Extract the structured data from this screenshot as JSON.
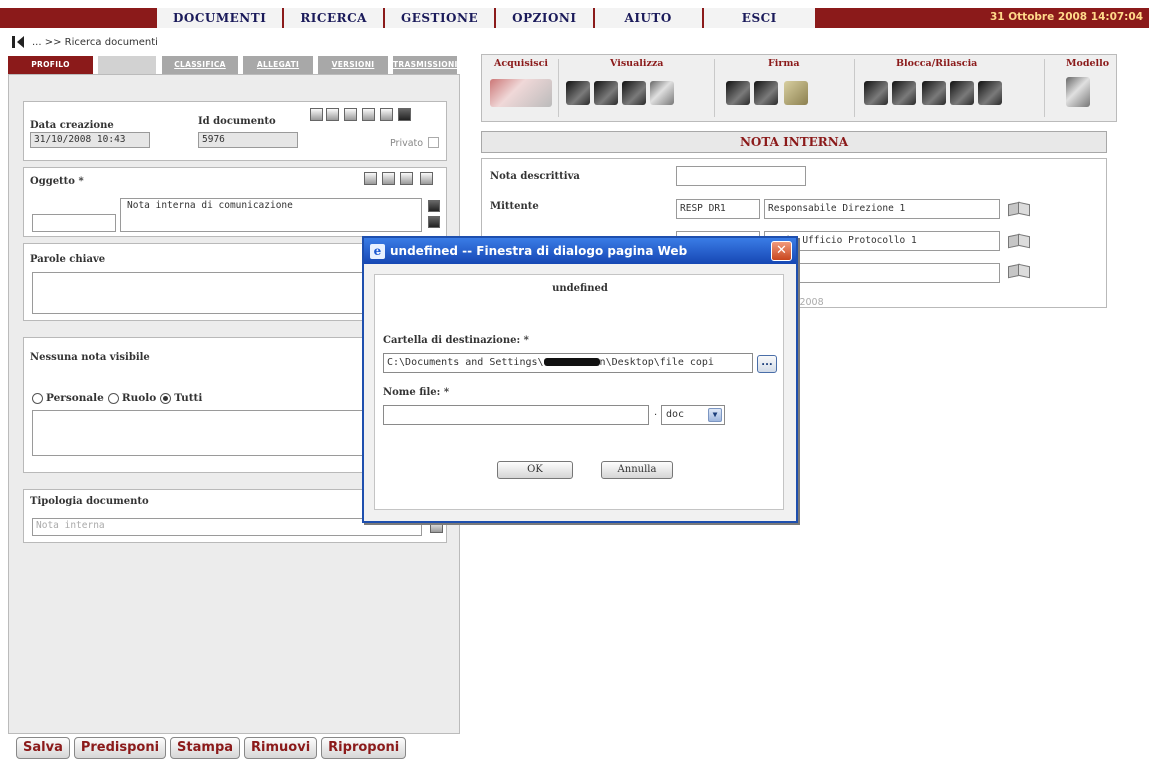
{
  "menu": {
    "items": [
      "DOCUMENTI",
      "RICERCA",
      "GESTIONE",
      "OPZIONI",
      "AIUTO",
      "ESCI"
    ],
    "datetime": "31 Ottobre 2008 14:07:04"
  },
  "breadcrumb": "... >> Ricerca documenti",
  "left_tabs": {
    "profilo": "PROFILO",
    "classifica": "CLASSIFICA",
    "allegati": "ALLEGATI",
    "versioni": "VERSIONI",
    "trasmissioni": "TRASMISSIONI"
  },
  "profile": {
    "data_creazione_label": "Data creazione",
    "data_creazione_value": "31/10/2008 10:43",
    "id_documento_label": "Id documento",
    "id_documento_value": "5976",
    "privato_label": "Privato",
    "oggetto_label": "Oggetto *",
    "oggetto_value": "Nota interna di comunicazione",
    "parole_chiave_label": "Parole chiave",
    "note_label": "Nessuna nota visibile",
    "radio_options": [
      "Personale",
      "Ruolo",
      "Tutti"
    ],
    "radio_selected": "Tutti",
    "tipologia_label": "Tipologia documento",
    "tipologia_value": "Nota interna"
  },
  "bottom_buttons": [
    "Salva",
    "Predisponi",
    "Stampa",
    "Rimuovi",
    "Riproponi"
  ],
  "toolbar_groups": [
    "Acquisisci",
    "Visualizza",
    "Firma",
    "Blocca/Rilascia",
    "Modello"
  ],
  "nota": {
    "header": "NOTA INTERNA",
    "nota_descrittiva_label": "Nota descrittiva",
    "mittente_label": "Mittente",
    "mittente_code": "RESP DR1",
    "mittente_desc": "Responsabile Direzione 1",
    "destinatario_desc": "tario Ufficio Protocollo 1",
    "date_fragment": "2-2008"
  },
  "dialog": {
    "title": "undefined -- Finestra di dialogo pagina Web",
    "heading": "undefined",
    "folder_label": "Cartella di destinazione: *",
    "folder_value_prefix": "C:\\Documents and Settings\\",
    "folder_value_suffix": "n\\Desktop\\file copi",
    "browse_label": "...",
    "filename_label": "Nome file: *",
    "filename_value": "",
    "ext_dot": ".",
    "ext_value": "doc",
    "ok_label": "OK",
    "cancel_label": "Annulla"
  },
  "colors": {
    "brand": "#8b1a1a",
    "dialog_border": "#1e4fae"
  }
}
